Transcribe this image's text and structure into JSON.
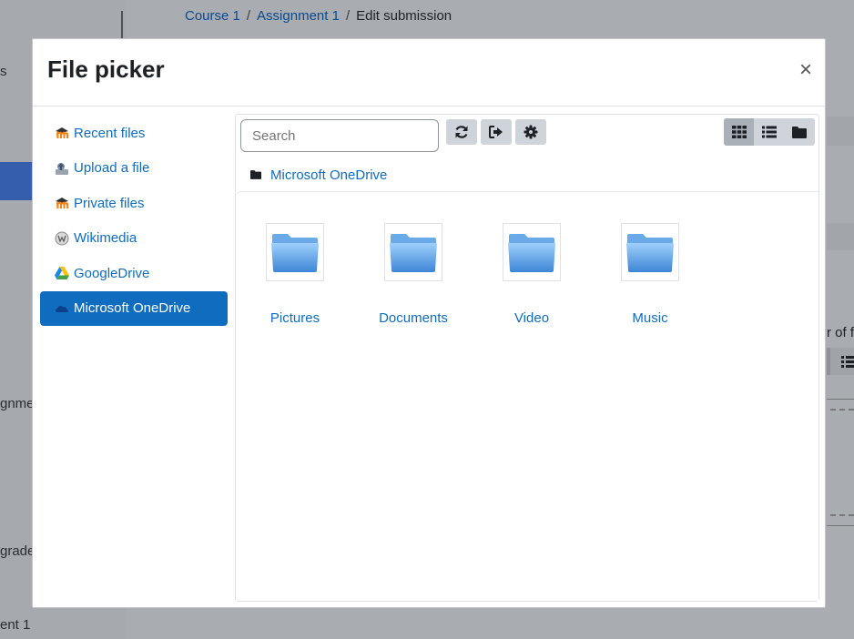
{
  "background": {
    "breadcrumb": [
      "Course 1",
      "Assignment 1",
      "Edit submission"
    ],
    "left_fragments": [
      "s",
      "gnme",
      "grade",
      "ent 1"
    ],
    "right_fragment": "r of f"
  },
  "modal": {
    "title": "File picker",
    "close_label": "×"
  },
  "repositories": [
    {
      "label": "Recent files",
      "icon": "moodle-icon"
    },
    {
      "label": "Upload a file",
      "icon": "upload-icon"
    },
    {
      "label": "Private files",
      "icon": "moodle-icon"
    },
    {
      "label": "Wikimedia",
      "icon": "wikimedia-icon"
    },
    {
      "label": "GoogleDrive",
      "icon": "googledrive-icon"
    },
    {
      "label": "Microsoft OneDrive",
      "icon": "onedrive-icon",
      "active": true
    }
  ],
  "toolbar": {
    "search_placeholder": "Search",
    "refresh_label": "refresh",
    "logout_label": "logout",
    "settings_label": "settings",
    "view_active": "icons"
  },
  "path": {
    "current": "Microsoft OneDrive"
  },
  "files": [
    {
      "name": "Pictures"
    },
    {
      "name": "Documents"
    },
    {
      "name": "Video"
    },
    {
      "name": "Music"
    }
  ],
  "colors": {
    "link": "#0f6cbf",
    "active_bg": "#0f6cbf",
    "button_bg": "#ced4da"
  }
}
